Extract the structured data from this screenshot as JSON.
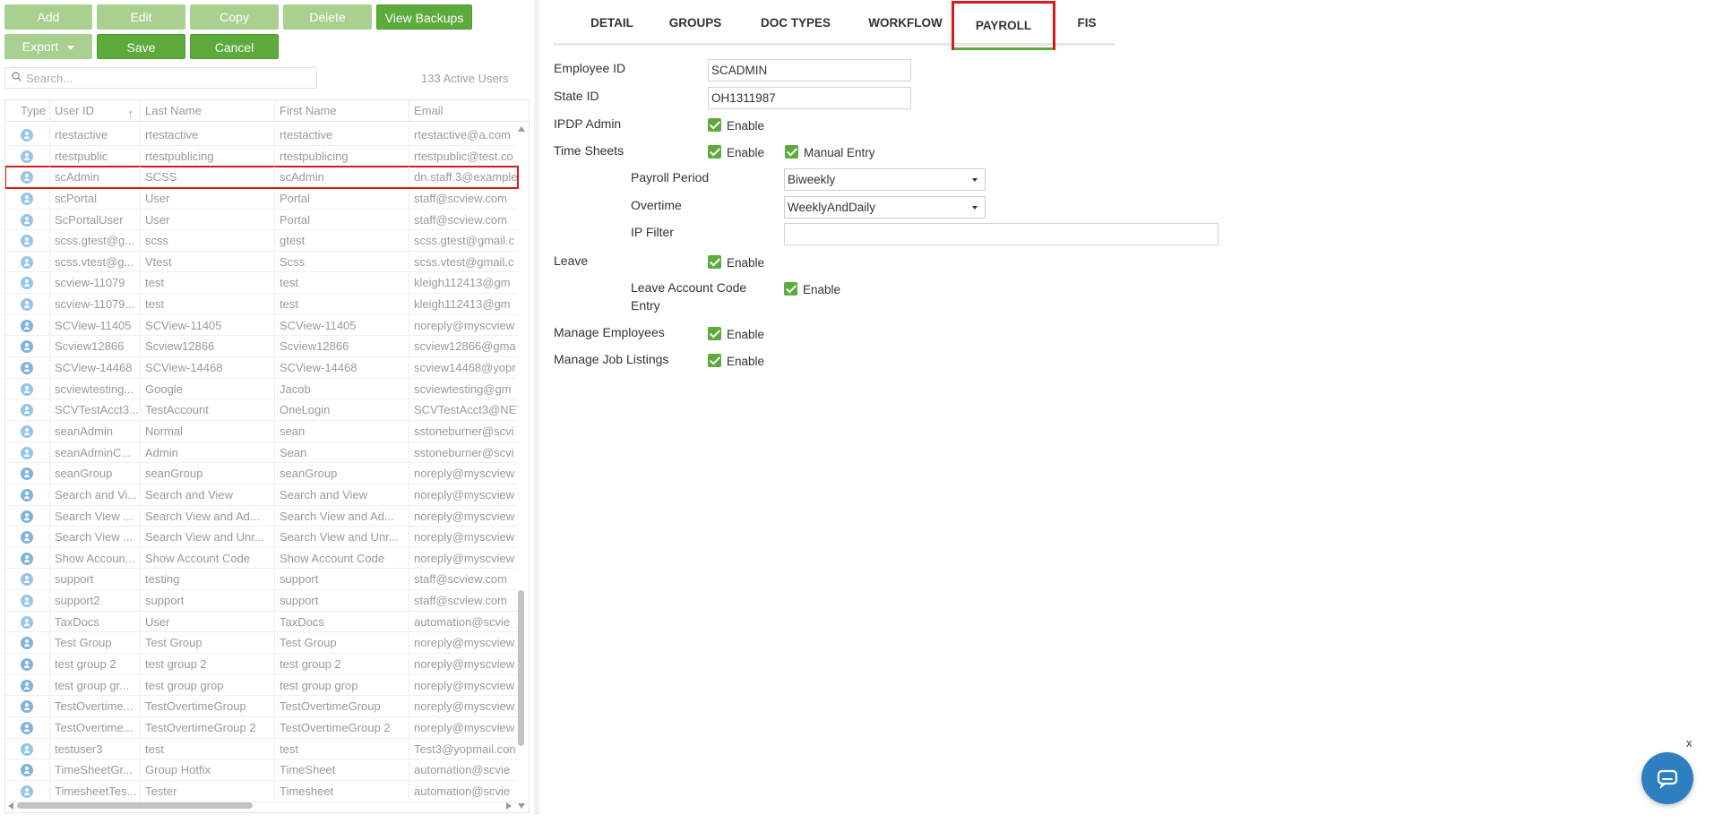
{
  "toolbar": {
    "add": "Add",
    "edit": "Edit",
    "copy": "Copy",
    "delete": "Delete",
    "view_backups": "View Backups",
    "export": "Export",
    "save": "Save",
    "cancel": "Cancel"
  },
  "search": {
    "placeholder": "Search...",
    "value": ""
  },
  "active_count": "133 Active Users",
  "grid": {
    "columns": [
      "Type",
      "User ID",
      "Last Name",
      "First Name",
      "Email"
    ],
    "sort_indicator": "↑",
    "rows": [
      {
        "type": "user",
        "uid": "rtestactive",
        "last": "rtestactive",
        "first": "rtestactive",
        "email": "rtestactive@a.com"
      },
      {
        "type": "user",
        "uid": "rtestpublic",
        "last": "rtestpublicing",
        "first": "rtestpublicing",
        "email": "rtestpublic@test.co"
      },
      {
        "type": "user",
        "uid": "scAdmin",
        "last": "SCSS",
        "first": "scAdmin",
        "email": "dn.staff.3@example",
        "selected": true
      },
      {
        "type": "user",
        "uid": "scPortal",
        "last": "User",
        "first": "Portal",
        "email": "staff@scview.com"
      },
      {
        "type": "user",
        "uid": "ScPortalUser",
        "last": "User",
        "first": "Portal",
        "email": "staff@scview.com"
      },
      {
        "type": "user",
        "uid": "scss.gtest@g...",
        "last": "scss",
        "first": "gtest",
        "email": "scss.gtest@gmail.c"
      },
      {
        "type": "user",
        "uid": "scss.vtest@g...",
        "last": "Vtest",
        "first": "Scss",
        "email": "scss.vtest@gmail.c"
      },
      {
        "type": "user",
        "uid": "scview-11079",
        "last": "test",
        "first": "test",
        "email": "kleigh112413@gm"
      },
      {
        "type": "user",
        "uid": "scview-11079...",
        "last": "test",
        "first": "test",
        "email": "kleigh112413@gm"
      },
      {
        "type": "group",
        "uid": "SCView-11405",
        "last": "SCView-11405",
        "first": "SCView-11405",
        "email": "noreply@myscview"
      },
      {
        "type": "group",
        "uid": "Scview12866",
        "last": "Scview12866",
        "first": "Scview12866",
        "email": "scview12866@gma"
      },
      {
        "type": "group",
        "uid": "SCView-14468",
        "last": "SCView-14468",
        "first": "SCView-14468",
        "email": "scview14468@yopr"
      },
      {
        "type": "user",
        "uid": "scviewtesting...",
        "last": "Google",
        "first": "Jacob",
        "email": "scviewtesting@gm"
      },
      {
        "type": "user",
        "uid": "SCVTestAcct3...",
        "last": "TestAccount",
        "first": "OneLogin",
        "email": "SCVTestAcct3@NET"
      },
      {
        "type": "user",
        "uid": "seanAdmin",
        "last": "Normal",
        "first": "sean",
        "email": "sstoneburner@scvi"
      },
      {
        "type": "user",
        "uid": "seanAdminC...",
        "last": "Admin",
        "first": "Sean",
        "email": "sstoneburner@scvi"
      },
      {
        "type": "group",
        "uid": "seanGroup",
        "last": "seanGroup",
        "first": "seanGroup",
        "email": "noreply@myscview"
      },
      {
        "type": "group",
        "uid": "Search and Vi...",
        "last": "Search and View",
        "first": "Search and View",
        "email": "noreply@myscview"
      },
      {
        "type": "group",
        "uid": "Search View ...",
        "last": "Search View and Ad...",
        "first": "Search View and Ad...",
        "email": "noreply@myscview"
      },
      {
        "type": "group",
        "uid": "Search View ...",
        "last": "Search View and Unr...",
        "first": "Search View and Unr...",
        "email": "noreply@myscview"
      },
      {
        "type": "group",
        "uid": "Show Accoun...",
        "last": "Show Account Code",
        "first": "Show Account Code",
        "email": "noreply@myscview"
      },
      {
        "type": "user",
        "uid": "support",
        "last": "testing",
        "first": "support",
        "email": "staff@scview.com"
      },
      {
        "type": "user",
        "uid": "support2",
        "last": "support",
        "first": "support",
        "email": "staff@scview.com"
      },
      {
        "type": "user",
        "uid": "TaxDocs",
        "last": "User",
        "first": "TaxDocs",
        "email": "automation@scvie"
      },
      {
        "type": "group",
        "uid": "Test Group",
        "last": "Test Group",
        "first": "Test Group",
        "email": "noreply@myscview"
      },
      {
        "type": "group",
        "uid": "test group 2",
        "last": "test group 2",
        "first": "test group 2",
        "email": "noreply@myscview"
      },
      {
        "type": "group",
        "uid": "test group gr...",
        "last": "test group grop",
        "first": "test group grop",
        "email": "noreply@myscview"
      },
      {
        "type": "group",
        "uid": "TestOvertime...",
        "last": "TestOvertimeGroup",
        "first": "TestOvertimeGroup",
        "email": "noreply@myscview"
      },
      {
        "type": "group",
        "uid": "TestOvertime...",
        "last": "TestOvertimeGroup 2",
        "first": "TestOvertimeGroup 2",
        "email": "noreply@myscview"
      },
      {
        "type": "user",
        "uid": "testuser3",
        "last": "test",
        "first": "test",
        "email": "Test3@yopmail.con"
      },
      {
        "type": "group",
        "uid": "TimeSheetGr...",
        "last": "Group Hotfix",
        "first": "TimeSheet",
        "email": "automation@scvie"
      },
      {
        "type": "user",
        "uid": "TimesheetTes...",
        "last": "Tester",
        "first": "Timesheet",
        "email": "automation@scvie"
      }
    ]
  },
  "tabs": [
    {
      "label": "DETAIL"
    },
    {
      "label": "GROUPS"
    },
    {
      "label": "DOC TYPES"
    },
    {
      "label": "WORKFLOW"
    },
    {
      "label": "PAYROLL",
      "active": true
    },
    {
      "label": "FIS"
    }
  ],
  "payroll": {
    "employee_id_label": "Employee ID",
    "employee_id_value": "SCADMIN",
    "state_id_label": "State ID",
    "state_id_value": "OH1311987",
    "ipdp_admin_label": "IPDP Admin",
    "enable_label": "Enable",
    "time_sheets_label": "Time Sheets",
    "manual_entry_label": "Manual Entry",
    "payroll_period_label": "Payroll Period",
    "payroll_period_value": "Biweekly",
    "overtime_label": "Overtime",
    "overtime_value": "WeeklyAndDaily",
    "ip_filter_label": "IP Filter",
    "ip_filter_value": "",
    "leave_label": "Leave",
    "leave_account_code_label_1": "Leave Account Code",
    "leave_account_code_label_2": "Entry",
    "manage_employees_label": "Manage Employees",
    "manage_job_listings_label": "Manage Job Listings"
  },
  "chat": {
    "close": "x"
  },
  "colors": {
    "accent_green": "#5cab3c",
    "light_green": "#a9d08e",
    "highlight_red": "#d9191a",
    "chat_blue": "#2d7fc1"
  }
}
